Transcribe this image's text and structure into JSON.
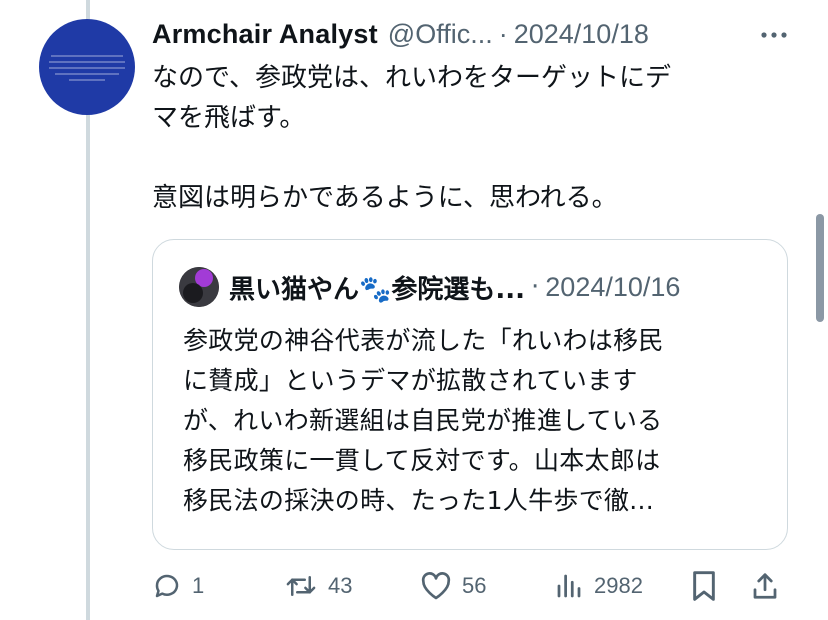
{
  "tweet": {
    "author_name": "Armchair Analyst",
    "author_handle": "@Offic...",
    "separator": "·",
    "date": "2024/10/18",
    "more_icon": "more-horizontal-icon",
    "body_lines": [
      "なので、参政党は、れいわをターゲットにデ",
      "マを飛ばす。",
      "意図は明らかであるように、思われる。"
    ]
  },
  "quote": {
    "author_name": "黒い猫やん🐾参院選も...",
    "separator": "·",
    "date": "2024/10/16",
    "text_lines": [
      "参政党の神谷代表が流した「れいわは移民",
      "に賛成」というデマが拡散されています",
      "が、れいわ新選組は自民党が推進している",
      "移民政策に一貫して反対です。山本太郎は",
      "移民法の採決の時、たった1人牛歩で徹..."
    ]
  },
  "actions": {
    "reply_count": "1",
    "repost_count": "43",
    "like_count": "56",
    "view_count": "2982",
    "icons": [
      "reply-icon",
      "repost-icon",
      "like-icon",
      "views-icon",
      "bookmark-icon",
      "share-icon"
    ]
  },
  "colors": {
    "text_primary": "#0f1419",
    "text_secondary": "#536471",
    "border": "#cfd9de",
    "avatar_bg": "#1f3aa6"
  }
}
